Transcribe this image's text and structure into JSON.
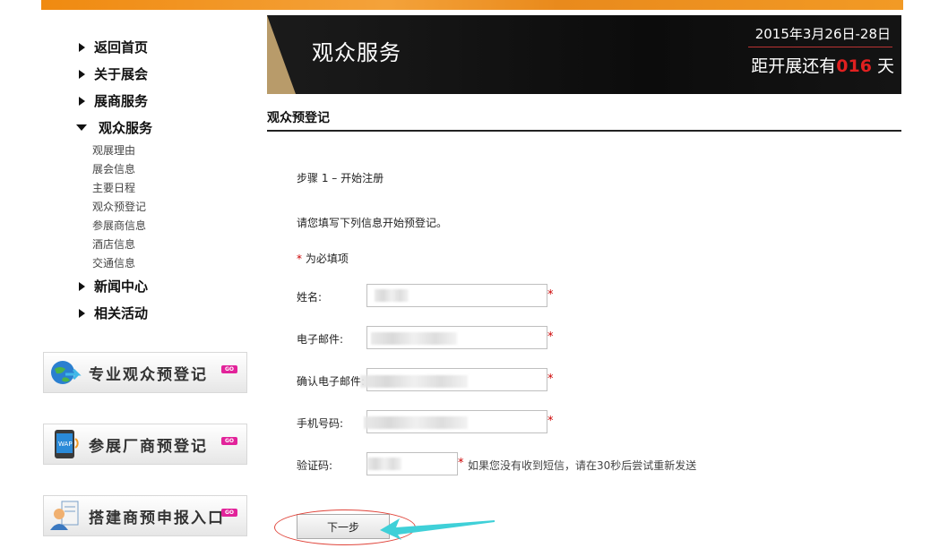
{
  "sidebar": {
    "nav": [
      {
        "label": "返回首页",
        "expanded": false
      },
      {
        "label": "关于展会",
        "expanded": false
      },
      {
        "label": "展商服务",
        "expanded": false
      },
      {
        "label": "观众服务",
        "expanded": true
      },
      {
        "label": "新闻中心",
        "expanded": false
      },
      {
        "label": "相关活动",
        "expanded": false
      }
    ],
    "sub": [
      "观展理由",
      "展会信息",
      "主要日程",
      "观众预登记",
      "参展商信息",
      "酒店信息",
      "交通信息"
    ],
    "promos": [
      {
        "label": "专业观众预登记",
        "icon": "globe-arrow-icon",
        "badge": "GO"
      },
      {
        "label": "参展厂商预登记",
        "icon": "wap-phone-icon",
        "badge": "GO"
      },
      {
        "label": "搭建商预申报入口",
        "icon": "user-document-icon",
        "badge": "GO"
      }
    ]
  },
  "banner": {
    "title": "观众服务",
    "date": "2015年3月26日-28日",
    "countdown_prefix": "距开展还有",
    "countdown_days": "016",
    "countdown_suffix": " 天"
  },
  "main": {
    "section_title": "观众预登记",
    "step": "步骤 1 – 开始注册",
    "intro": "请您填写下列信息开始预登记。",
    "required_mark": "*",
    "required_note": " 为必填项",
    "fields": [
      {
        "label": "姓名:",
        "value": ""
      },
      {
        "label": "电子邮件:",
        "value": ""
      },
      {
        "label": "确认电子邮件:",
        "value": ""
      },
      {
        "label": "手机号码:",
        "value": ""
      },
      {
        "label": "验证码:",
        "value": ""
      }
    ],
    "captcha_hint": "如果您没有收到短信，请在30秒后尝试重新发送",
    "next_button": "下一步"
  },
  "colors": {
    "accent_orange": "#f08a10",
    "countdown_red": "#e02020",
    "required_red": "#cc0000",
    "annotation_arrow": "#3fd0d8",
    "annotation_ellipse": "#e0443a",
    "go_badge": "#e2239a"
  }
}
